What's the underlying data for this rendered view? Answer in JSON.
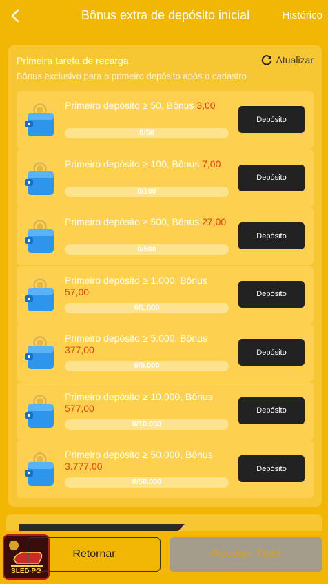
{
  "header": {
    "title": "Bônus extra de depósito inicial",
    "history_label": "Histórico"
  },
  "panel": {
    "title": "Primeira tarefa de recarga",
    "refresh_label": "Atualizar",
    "subtitle": "Bônus exclusivo para o primeiro depósito após o cadastro"
  },
  "tasks": [
    {
      "text": "Primeiro depósito ≥ 50, Bônus",
      "bonus": "3,00",
      "progress_text": "0/50",
      "progress": 0,
      "button": "Depósito"
    },
    {
      "text": "Primeiro depósito ≥ 100, Bônus",
      "bonus": "7,00",
      "progress_text": "0/100",
      "progress": 0,
      "button": "Depósito"
    },
    {
      "text": "Primeiro depósito ≥ 500, Bônus",
      "bonus": "27,00",
      "progress_text": "0/500",
      "progress": 0,
      "button": "Depósito"
    },
    {
      "text": "Primeiro depósito ≥ 1.000, Bônus",
      "bonus": "57,00",
      "progress_text": "0/1.000",
      "progress": 0,
      "button": "Depósito"
    },
    {
      "text": "Primeiro depósito ≥ 5.000, Bônus",
      "bonus": "377,00",
      "progress_text": "0/5.000",
      "progress": 0,
      "button": "Depósito"
    },
    {
      "text": "Primeiro depósito ≥ 10.000, Bônus",
      "bonus": "577,00",
      "progress_text": "0/10.000",
      "progress": 0,
      "button": "Depósito"
    },
    {
      "text": "Primeiro depósito ≥ 50.000, Bônus",
      "bonus": "3.777,00",
      "progress_text": "0/50.000",
      "progress": 0,
      "button": "Depósito"
    }
  ],
  "footer": {
    "logo_text": "SLED PG",
    "return_label": "Retornar",
    "receive_all_label": "Receber Tudo"
  },
  "colors": {
    "accent": "#f2b705",
    "bonus": "#e9400f",
    "button_dark": "#222222"
  },
  "icons": {
    "back": "chevron-left-icon",
    "refresh": "refresh-icon",
    "task": "wallet-coin-icon"
  }
}
